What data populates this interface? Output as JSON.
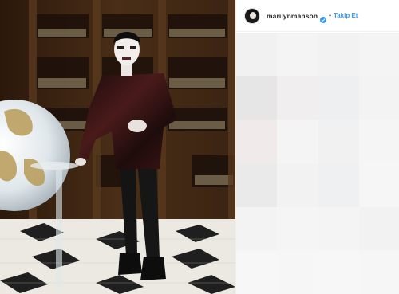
{
  "post": {
    "username": "marilynmanson",
    "separator": "•",
    "follow_label": "Takip Et",
    "verified": true
  },
  "colors": {
    "follow_blue": "#3897f0",
    "verified_blue": "#3897f0",
    "text_dark": "#262626",
    "border": "#efefef"
  },
  "icons": {
    "verified": "verified-badge-icon",
    "avatar": "profile-avatar"
  },
  "comments_area": {
    "state": "pixelated",
    "cell_colors": [
      "#f1f1f1",
      "#f5f4f4",
      "#f2f2f3",
      "#f4f4f4",
      "#e6e6e7",
      "#f0eeef",
      "#eeeff0",
      "#f3f3f3",
      "#f1eaea",
      "#f4f4f4",
      "#f1f1f2",
      "#f5f5f5",
      "#eaeaeb",
      "#f2f2f2",
      "#eff0f2",
      "#f6f6f6",
      "#f3f3f3",
      "#f5f5f5",
      "#f4f4f4",
      "#f2f2f2",
      "#f7f7f7",
      "#f6f6f6",
      "#f7f7f7",
      "#f6f6f6"
    ]
  }
}
